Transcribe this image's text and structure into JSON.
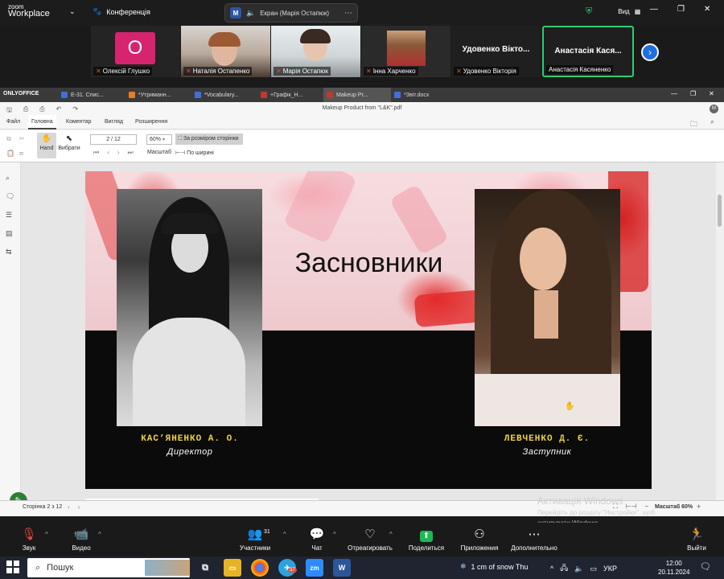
{
  "zoom": {
    "logo_line1": "zoom",
    "logo_line2": "Workplace",
    "conference_label": "Конференція",
    "screen_share_label": "Екран (Марія Остапюк)",
    "view_label": "Вид",
    "participants": [
      {
        "name": "Олексій Глушко",
        "initial": "О",
        "muted": true
      },
      {
        "name": "Наталія Остапенко",
        "muted": true
      },
      {
        "name": "Марія Остапюк",
        "muted": true
      },
      {
        "name": "Інна Харченко",
        "muted": true
      },
      {
        "name": "Удовенко Вікторія",
        "display": "Удовенко Вікто...",
        "muted": true
      },
      {
        "name": "Анастасія Касяненко",
        "display": "Анастасія Кася...",
        "muted": false
      }
    ],
    "toolbar": {
      "audio": "Звук",
      "video": "Видео",
      "participants": "Участники",
      "participants_count": "31",
      "chat": "Чат",
      "react": "Отреагировать",
      "share": "Поделиться",
      "apps": "Приложения",
      "more": "Дополнительно",
      "leave": "Выйти"
    }
  },
  "onlyoffice": {
    "brand": "ONLYOFFICE",
    "tabs": [
      "Е-31. Спис...",
      "*Утриманн...",
      "*Vocabulary...",
      "+Графік_Н...",
      "Makeup Pr...",
      "*Звіт.docx"
    ],
    "window_title": "Makeup Product from \"L&K\".pdf",
    "menu": [
      "Файл",
      "Головна",
      "Коментар",
      "Вигляд",
      "Розширення"
    ],
    "active_menu": "Головна",
    "toolbar": {
      "hand": "Hand",
      "select": "Вибрати",
      "page_field": "2 / 12",
      "zoom_value": "60%",
      "fit_page": "За розміром сторінки",
      "scale_label": "Масштаб",
      "fit_width": "По ширині"
    },
    "status": {
      "page_info": "Сторінка 2 з 12",
      "zoom_label": "Масштаб 60%"
    }
  },
  "slide": {
    "title": "Засновники",
    "founders": [
      {
        "name": "КАС’ЯНЕНКО А. О.",
        "role": "Директор"
      },
      {
        "name": "ЛЕВЧЕНКО Д. Є.",
        "role": "Заступник"
      }
    ]
  },
  "watermark": {
    "title": "Активація Windows",
    "line1": "Перейдіть до розділу \"Настройки\", щоб",
    "line2": "активувати Windows."
  },
  "taskbar": {
    "search_placeholder": "Пошук",
    "weather": "1 cm of snow Thu",
    "language": "УКР",
    "time": "12:00",
    "date": "20.11.2024",
    "telegram_badge": "37"
  }
}
